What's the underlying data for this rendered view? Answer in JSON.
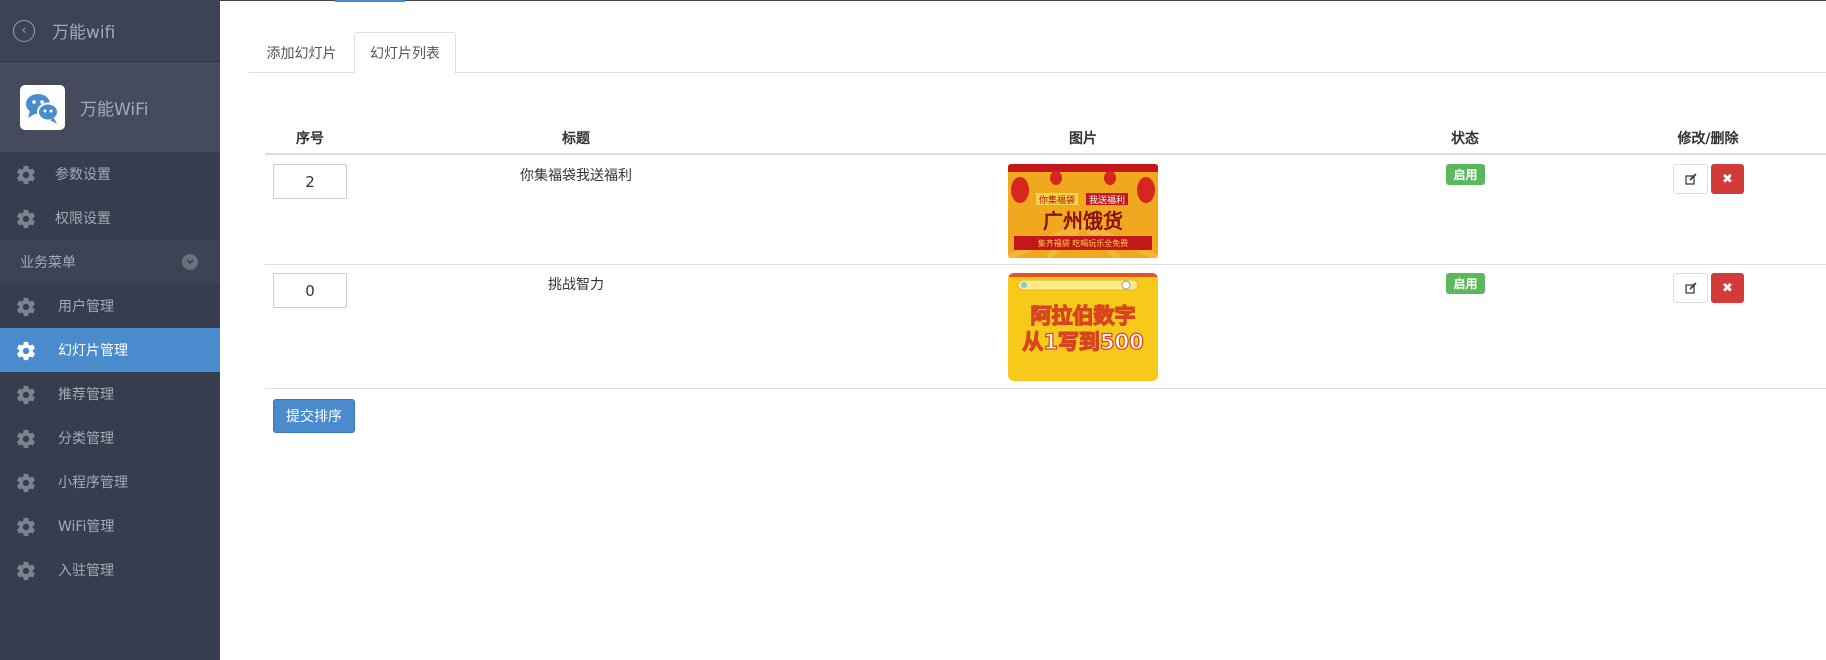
{
  "app": {
    "title": "万能wifi",
    "brand_name": "万能WiFi"
  },
  "sidebar": {
    "items_top": [
      {
        "label": "参数设置",
        "icon": "gear-icon"
      },
      {
        "label": "权限设置",
        "icon": "gear-icon"
      }
    ],
    "group": {
      "label": "业务菜单",
      "icon": "chevron-down-icon"
    },
    "items": [
      {
        "label": "用户管理",
        "icon": "gear-icon",
        "active": false
      },
      {
        "label": "幻灯片管理",
        "icon": "gear-icon",
        "active": true
      },
      {
        "label": "推荐管理",
        "icon": "gear-icon",
        "active": false
      },
      {
        "label": "分类管理",
        "icon": "gear-icon",
        "active": false
      },
      {
        "label": "小程序管理",
        "icon": "gear-icon",
        "active": false
      },
      {
        "label": "WiFi管理",
        "icon": "gear-icon",
        "active": false
      },
      {
        "label": "入驻管理",
        "icon": "gear-icon",
        "active": false
      }
    ]
  },
  "tabs": [
    {
      "label": "添加幻灯片",
      "active": false
    },
    {
      "label": "幻灯片列表",
      "active": true
    }
  ],
  "table": {
    "headers": {
      "order": "序号",
      "title": "标题",
      "image": "图片",
      "status": "状态",
      "actions": "修改/删除"
    },
    "rows": [
      {
        "order": "2",
        "title": "你集福袋我送福利",
        "status": "启用",
        "image": {
          "top_left": "你集福袋",
          "top_right": "我送福利",
          "main": "广州饿货",
          "bottom": "集齐福袋 吃喝玩乐全免费"
        }
      },
      {
        "order": "0",
        "title": "挑战智力",
        "status": "启用",
        "image": {
          "line1": "阿拉伯数字",
          "line2": "从1写到500"
        }
      }
    ]
  },
  "submit_label": "提交排序",
  "colors": {
    "sidebar_bg": "#373d4f",
    "active": "#4a8bcd",
    "success": "#5cb85c",
    "danger": "#d33a3a"
  }
}
